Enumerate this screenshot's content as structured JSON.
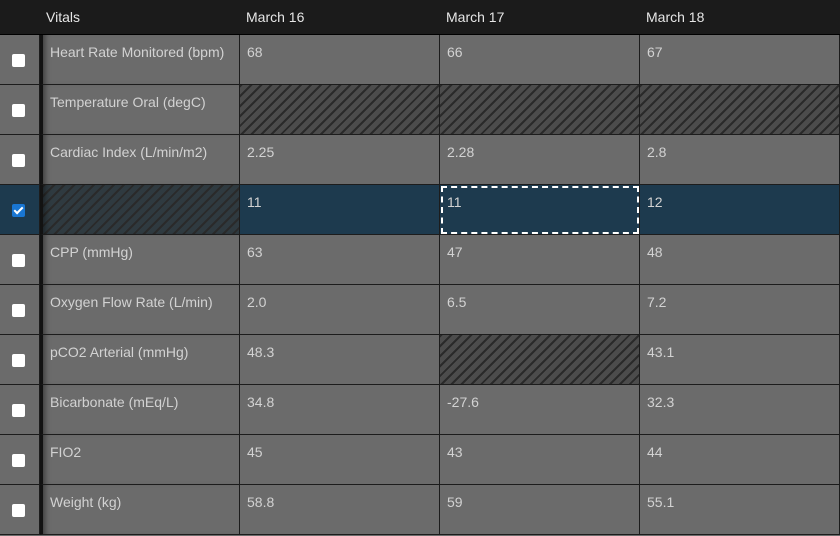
{
  "columns": {
    "label": "Vitals",
    "day1": "March 16",
    "day2": "March 17",
    "day3": "March 18"
  },
  "rows": [
    {
      "label": "Heart Rate Monitored (bpm)",
      "v1": "68",
      "v2": "66",
      "v3": "67",
      "checked": false
    },
    {
      "label": "Temperature Oral (degC)",
      "v1": "",
      "v2": "",
      "v3": "",
      "checked": false
    },
    {
      "label": "Cardiac Index (L/min/m2)",
      "v1": "2.25",
      "v2": "2.28",
      "v3": "2.8",
      "checked": false
    },
    {
      "label": "",
      "v1": "11",
      "v2": "11",
      "v3": "12",
      "checked": true
    },
    {
      "label": "CPP (mmHg)",
      "v1": "63",
      "v2": "47",
      "v3": "48",
      "checked": false
    },
    {
      "label": "Oxygen Flow Rate (L/min)",
      "v1": "2.0",
      "v2": "6.5",
      "v3": "7.2",
      "checked": false
    },
    {
      "label": "pCO2 Arterial (mmHg)",
      "v1": "48.3",
      "v2": "",
      "v3": "43.1",
      "checked": false
    },
    {
      "label": "Bicarbonate (mEq/L)",
      "v1": "34.8",
      "v2": "-27.6",
      "v3": "32.3",
      "checked": false
    },
    {
      "label": "FIO2",
      "v1": "45",
      "v2": "43",
      "v3": "44",
      "checked": false
    },
    {
      "label": "Weight (kg)",
      "v1": "58.8",
      "v2": "59",
      "v3": "55.1",
      "checked": false
    }
  ],
  "selected_row_index": 3,
  "focused_cell": "rows.3.v2",
  "colors": {
    "header_bg": "#1b1b1b",
    "cell_bg": "#6b6b6b",
    "selected_bg": "#1d3a4e",
    "checkbox_checked": "#1976d2"
  }
}
